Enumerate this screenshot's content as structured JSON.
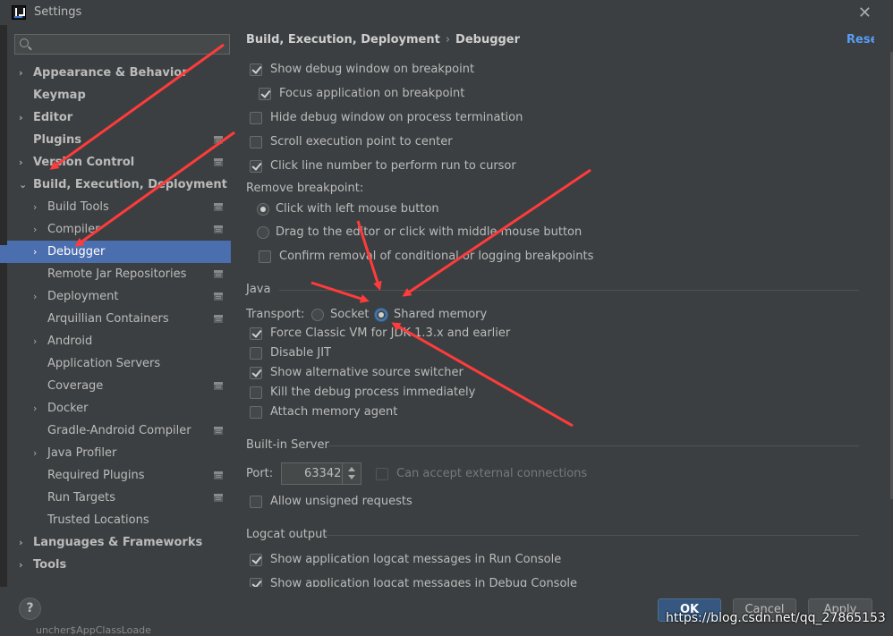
{
  "window": {
    "title": "Settings",
    "close_glyph": "✕"
  },
  "search": {
    "placeholder": "",
    "value": ""
  },
  "tree": [
    {
      "label": "Appearance & Behavior",
      "level": 0,
      "expandable": true,
      "expanded": false,
      "bold": true,
      "selected": false,
      "project_icon": false
    },
    {
      "label": "Keymap",
      "level": 0,
      "expandable": false,
      "expanded": false,
      "bold": true,
      "selected": false,
      "project_icon": false
    },
    {
      "label": "Editor",
      "level": 0,
      "expandable": true,
      "expanded": false,
      "bold": true,
      "selected": false,
      "project_icon": false
    },
    {
      "label": "Plugins",
      "level": 0,
      "expandable": false,
      "expanded": false,
      "bold": true,
      "selected": false,
      "project_icon": true
    },
    {
      "label": "Version Control",
      "level": 0,
      "expandable": true,
      "expanded": false,
      "bold": true,
      "selected": false,
      "project_icon": true
    },
    {
      "label": "Build, Execution, Deployment",
      "level": 0,
      "expandable": true,
      "expanded": true,
      "bold": true,
      "selected": false,
      "project_icon": false
    },
    {
      "label": "Build Tools",
      "level": 1,
      "expandable": true,
      "expanded": false,
      "bold": false,
      "selected": false,
      "project_icon": true
    },
    {
      "label": "Compiler",
      "level": 1,
      "expandable": true,
      "expanded": false,
      "bold": false,
      "selected": false,
      "project_icon": true
    },
    {
      "label": "Debugger",
      "level": 1,
      "expandable": true,
      "expanded": false,
      "bold": false,
      "selected": true,
      "project_icon": false
    },
    {
      "label": "Remote Jar Repositories",
      "level": 1,
      "expandable": false,
      "expanded": false,
      "bold": false,
      "selected": false,
      "project_icon": true
    },
    {
      "label": "Deployment",
      "level": 1,
      "expandable": true,
      "expanded": false,
      "bold": false,
      "selected": false,
      "project_icon": true
    },
    {
      "label": "Arquillian Containers",
      "level": 1,
      "expandable": false,
      "expanded": false,
      "bold": false,
      "selected": false,
      "project_icon": true
    },
    {
      "label": "Android",
      "level": 1,
      "expandable": true,
      "expanded": false,
      "bold": false,
      "selected": false,
      "project_icon": false
    },
    {
      "label": "Application Servers",
      "level": 1,
      "expandable": false,
      "expanded": false,
      "bold": false,
      "selected": false,
      "project_icon": false
    },
    {
      "label": "Coverage",
      "level": 1,
      "expandable": false,
      "expanded": false,
      "bold": false,
      "selected": false,
      "project_icon": true
    },
    {
      "label": "Docker",
      "level": 1,
      "expandable": true,
      "expanded": false,
      "bold": false,
      "selected": false,
      "project_icon": false
    },
    {
      "label": "Gradle-Android Compiler",
      "level": 1,
      "expandable": false,
      "expanded": false,
      "bold": false,
      "selected": false,
      "project_icon": true
    },
    {
      "label": "Java Profiler",
      "level": 1,
      "expandable": true,
      "expanded": false,
      "bold": false,
      "selected": false,
      "project_icon": false
    },
    {
      "label": "Required Plugins",
      "level": 1,
      "expandable": false,
      "expanded": false,
      "bold": false,
      "selected": false,
      "project_icon": true
    },
    {
      "label": "Run Targets",
      "level": 1,
      "expandable": false,
      "expanded": false,
      "bold": false,
      "selected": false,
      "project_icon": true
    },
    {
      "label": "Trusted Locations",
      "level": 1,
      "expandable": false,
      "expanded": false,
      "bold": false,
      "selected": false,
      "project_icon": false
    },
    {
      "label": "Languages & Frameworks",
      "level": 0,
      "expandable": true,
      "expanded": false,
      "bold": true,
      "selected": false,
      "project_icon": false
    },
    {
      "label": "Tools",
      "level": 0,
      "expandable": true,
      "expanded": false,
      "bold": true,
      "selected": false,
      "project_icon": false
    }
  ],
  "header": {
    "crumb_parent": "Build, Execution, Deployment",
    "crumb_sep": "›",
    "crumb_current": "Debugger",
    "reset": "Reset"
  },
  "general": {
    "show_debug_window": {
      "label": "Show debug window on breakpoint",
      "checked": true
    },
    "focus_application": {
      "label": "Focus application on breakpoint",
      "checked": true
    },
    "hide_debug_window": {
      "label": "Hide debug window on process termination",
      "checked": false
    },
    "scroll_execution": {
      "label": "Scroll execution point to center",
      "checked": false
    },
    "click_line_number": {
      "label": "Click line number to perform run to cursor",
      "checked": true
    },
    "remove_breakpoint_label": "Remove breakpoint:",
    "remove_left_click": {
      "label": "Click with left mouse button",
      "selected": true
    },
    "remove_drag": {
      "label": "Drag to the editor or click with middle mouse button",
      "selected": false
    },
    "confirm_removal": {
      "label": "Confirm removal of conditional or logging breakpoints",
      "checked": false
    }
  },
  "java": {
    "title": "Java",
    "transport_label": "Transport:",
    "transport_socket": {
      "label": "Socket",
      "selected": false
    },
    "transport_shared": {
      "label": "Shared memory",
      "selected": true
    },
    "force_classic_vm": {
      "label": "Force Classic VM for JDK 1.3.x and earlier",
      "checked": true
    },
    "disable_jit": {
      "label": "Disable JIT",
      "checked": false
    },
    "show_alt_source": {
      "label": "Show alternative source switcher",
      "checked": true
    },
    "kill_debug": {
      "label": "Kill the debug process immediately",
      "checked": false
    },
    "attach_memory_agent": {
      "label": "Attach memory agent",
      "checked": false
    }
  },
  "server": {
    "title": "Built-in Server",
    "port_label": "Port:",
    "port_value": "63342",
    "external_connections": {
      "label": "Can accept external connections",
      "checked": false,
      "enabled": false
    },
    "allow_unsigned": {
      "label": "Allow unsigned requests",
      "checked": false
    }
  },
  "logcat": {
    "title": "Logcat output",
    "run_console": {
      "label": "Show application logcat messages in Run Console",
      "checked": true
    },
    "debug_console": {
      "label": "Show application logcat messages in Debug Console",
      "checked": true
    }
  },
  "buttons": {
    "help": "?",
    "ok": "OK",
    "cancel": "Cancel",
    "apply": "Apply"
  },
  "watermark": "https://blog.csdn.net/qq_27865153",
  "background_fragment": "uncher$AppClassLoade",
  "colors": {
    "selection": "#4b6eaf",
    "accent_link": "#589df6",
    "annotation_arrow": "#ff3b3b",
    "ok_button": "#365880"
  }
}
